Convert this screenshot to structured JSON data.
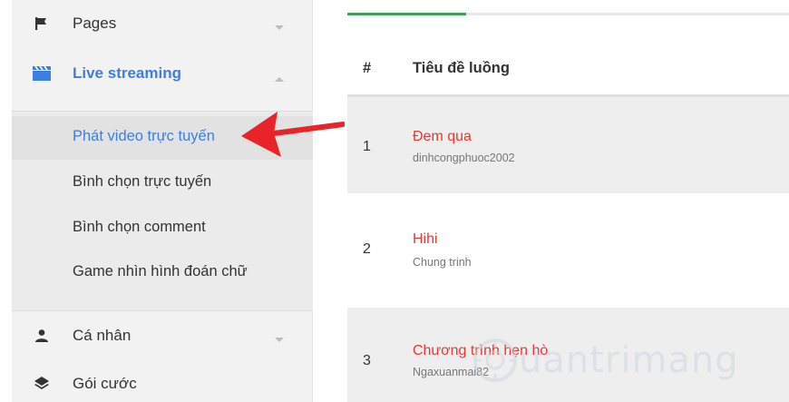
{
  "sidebar": {
    "items": [
      {
        "label": "Pages",
        "icon": "flag-icon"
      },
      {
        "label": "Live streaming",
        "icon": "clapperboard-icon"
      },
      {
        "label": "Cá nhân",
        "icon": "person-icon"
      },
      {
        "label": "Gói cước",
        "icon": "layers-icon"
      }
    ],
    "submenu": [
      {
        "label": "Phát video trực tuyến"
      },
      {
        "label": "Bình chọn trực tuyến"
      },
      {
        "label": "Bình chọn comment"
      },
      {
        "label": "Game nhìn hình đoán chữ"
      }
    ],
    "active_submenu_index": 0
  },
  "table": {
    "columns": [
      "#",
      "Tiêu đề luồng"
    ],
    "loading_progress_fraction": 0.27,
    "rows": [
      {
        "num": "1",
        "title": "Đem qua",
        "owner": "dinhcongphuoc2002"
      },
      {
        "num": "2",
        "title": "Hihi",
        "owner": "Chung trinh"
      },
      {
        "num": "3",
        "title": "Chương trình hẹn hò",
        "owner": "Ngaxuanmai82"
      }
    ]
  },
  "watermark": {
    "text": "uantrimang"
  },
  "colors": {
    "accent": "#3f7de0",
    "title_red": "#e53935",
    "progress_green": "#3aa05a",
    "arrow_red": "#e8232a"
  }
}
